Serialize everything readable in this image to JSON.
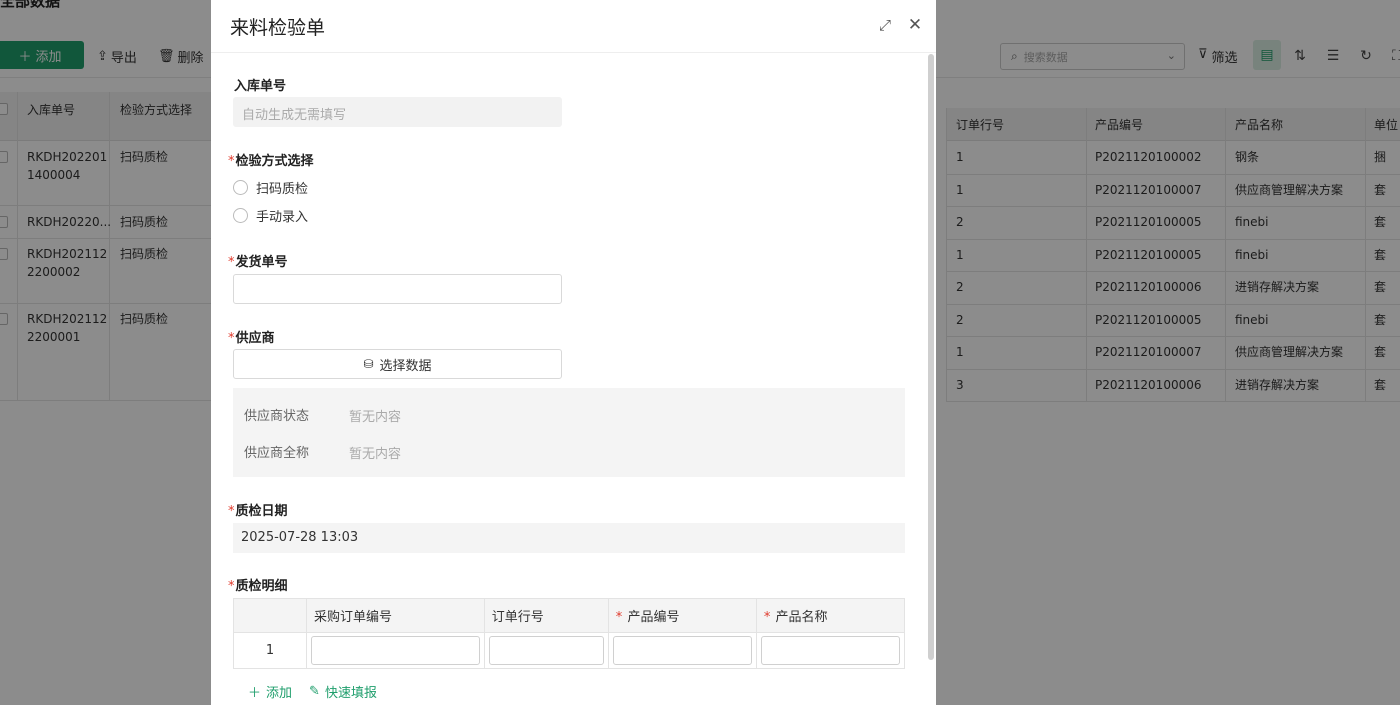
{
  "background": {
    "page_title": "全部数据",
    "toolbar": {
      "add_label": "添加",
      "export_label": "导出",
      "delete_label": "删除",
      "search_placeholder": "搜索数据",
      "filter_label": "筛选"
    },
    "left_table": {
      "columns": [
        "入库单号",
        "检验方式选择"
      ],
      "rows": [
        {
          "id_line1": "RKDH202201",
          "id_line2": "1400004",
          "method": "扫码质检"
        },
        {
          "id_line1": "RKDH20220...",
          "id_line2": "",
          "method": "扫码质检"
        },
        {
          "id_line1": "RKDH202112",
          "id_line2": "2200002",
          "method": "扫码质检"
        },
        {
          "id_line1": "RKDH202112",
          "id_line2": "2200001",
          "method": "扫码质检"
        }
      ]
    },
    "right_table": {
      "columns": [
        "订单行号",
        "产品编号",
        "产品名称",
        "单位"
      ],
      "rows": [
        [
          "1",
          "P2021120100002",
          "钢条",
          "捆"
        ],
        [
          "1",
          "P2021120100007",
          "供应商管理解决方案",
          "套"
        ],
        [
          "2",
          "P2021120100005",
          "finebi",
          "套"
        ],
        [
          "1",
          "P2021120100005",
          "finebi",
          "套"
        ],
        [
          "2",
          "P2021120100006",
          "进销存解决方案",
          "套"
        ],
        [
          "2",
          "P2021120100005",
          "finebi",
          "套"
        ],
        [
          "1",
          "P2021120100007",
          "供应商管理解决方案",
          "套"
        ],
        [
          "3",
          "P2021120100006",
          "进销存解决方案",
          "套"
        ]
      ]
    }
  },
  "modal": {
    "title": "来料检验单",
    "fields": {
      "receipt_no_label": "入库单号",
      "receipt_no_placeholder": "自动生成无需填写",
      "inspect_method_label": "检验方式选择",
      "inspect_options": [
        "扫码质检",
        "手动录入"
      ],
      "shipment_no_label": "发货单号",
      "supplier_label": "供应商",
      "select_data_label": "选择数据",
      "supplier_status_key": "供应商状态",
      "supplier_status_val": "暂无内容",
      "supplier_fullname_key": "供应商全称",
      "supplier_fullname_val": "暂无内容",
      "qc_date_label": "质检日期",
      "qc_date_value": "2025-07-28 13:03",
      "qc_detail_label": "质检明细"
    },
    "detail_table": {
      "columns": [
        "采购订单编号",
        "订单行号",
        "产品编号",
        "产品名称"
      ],
      "required_columns": [
        false,
        false,
        true,
        true
      ],
      "row_number": "1"
    },
    "footer": {
      "add_label": "添加",
      "quick_fill_label": "快速填报"
    }
  },
  "colors": {
    "accent": "#1f9e6c",
    "required": "#e0392b"
  }
}
